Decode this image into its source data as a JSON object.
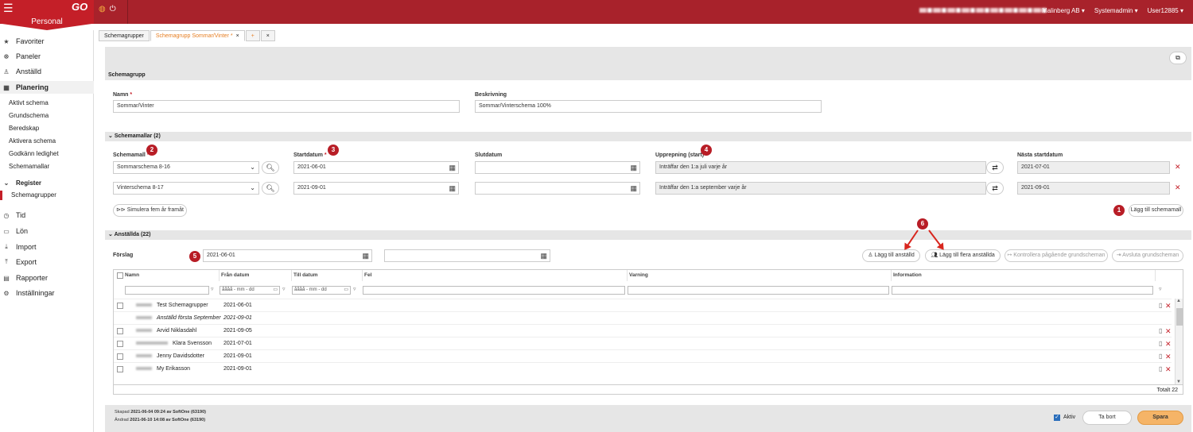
{
  "topbar": {
    "brand_label": "Personal",
    "logo_text": "GO",
    "company": "Malinberg AB",
    "role": "Systemadmin",
    "user": "User12885"
  },
  "sidebar": {
    "favoriter": "Favoriter",
    "paneler": "Paneler",
    "anstalld": "Anställd",
    "planering": "Planering",
    "planering_items": [
      "Aktivt schema",
      "Grundschema",
      "Beredskap",
      "Aktivera schema",
      "Godkänn ledighet",
      "Schemamallar"
    ],
    "register": "Register",
    "register_items": [
      "Schemagrupper"
    ],
    "tid": "Tid",
    "lon": "Lön",
    "import": "Import",
    "export": "Export",
    "rapporter": "Rapporter",
    "installningar": "Inställningar"
  },
  "tabs": {
    "tab1": "Schemagrupper",
    "tab2": "Schemagrupp Sommar/Vinter",
    "tab2_mark": "*",
    "plus": "+",
    "close": "×"
  },
  "schemagrupp": {
    "section_title": "Schemagrupp",
    "name_label": "Namn",
    "name_value": "Sommar/Vinter",
    "desc_label": "Beskrivning",
    "desc_value": "Sommar/Vinterschema 100%"
  },
  "schemamallar": {
    "section_title": "Schemamallar (2)",
    "col_schemamall": "Schemamall",
    "col_startdatum": "Startdatum",
    "col_slutdatum": "Slutdatum",
    "col_upprepning": "Upprepning (start)",
    "col_nasta": "Nästa startdatum",
    "rows": [
      {
        "schemamall": "Sommarschema 8-16",
        "startdatum": "2021-06-01",
        "slutdatum": "",
        "upprepning": "Inträffar den 1:a juli varje år",
        "nasta": "2021-07-01"
      },
      {
        "schemamall": "Vinterschema 8-17",
        "startdatum": "2021-09-01",
        "slutdatum": "",
        "upprepning": "Inträffar den 1:a september varje år",
        "nasta": "2021-09-01"
      }
    ],
    "simulate_button": "Simulera fem år framåt",
    "add_template_button": "Lägg till schemamall"
  },
  "anstallda": {
    "section_title": "Anställda (22)",
    "forslag_label": "Förslag",
    "forslag_from": "2021-06-01",
    "forslag_to": "",
    "add_employee_button": "Lägg till anställd",
    "add_multiple_button": "Lägg till flera anställda",
    "check_running_button": "Kontrollera pågående grundscheman",
    "end_button": "Avsluta grundscheman",
    "columns": [
      "Namn",
      "Från datum",
      "Till datum",
      "Fel",
      "Varning",
      "Information"
    ],
    "date_filter_placeholder": "åååå - mm - dd",
    "rows": [
      {
        "name": "Test Schemagrupper",
        "from": "2021-06-01",
        "italic": false
      },
      {
        "name": "Anställd första September",
        "from": "2021-09-01",
        "italic": true
      },
      {
        "name": "Arvid Niklasdahl",
        "from": "2021-09-05",
        "italic": false
      },
      {
        "name": "Klara Svensson",
        "from": "2021-07-01",
        "italic": false
      },
      {
        "name": "Jenny Davidsdotter",
        "from": "2021-09-01",
        "italic": false
      },
      {
        "name": "My Erikasson",
        "from": "2021-09-01",
        "italic": false
      }
    ],
    "total": "Totalt 22"
  },
  "badges": [
    "1",
    "2",
    "3",
    "4",
    "5",
    "6"
  ],
  "footer": {
    "created_label": "Skapad",
    "created_value": "2021-06-04 09:24 av SoftOne (63190)",
    "modified_label": "Ändrad",
    "modified_value": "2021-06-10 14:08 av SoftOne (63190)",
    "active_label": "Aktiv",
    "cancel_button": "Ta bort",
    "save_button": "Spara"
  },
  "colors": {
    "brand": "#c41f28",
    "topbar": "#a8222b",
    "accent": "#e67e22",
    "save": "#f5b467"
  }
}
